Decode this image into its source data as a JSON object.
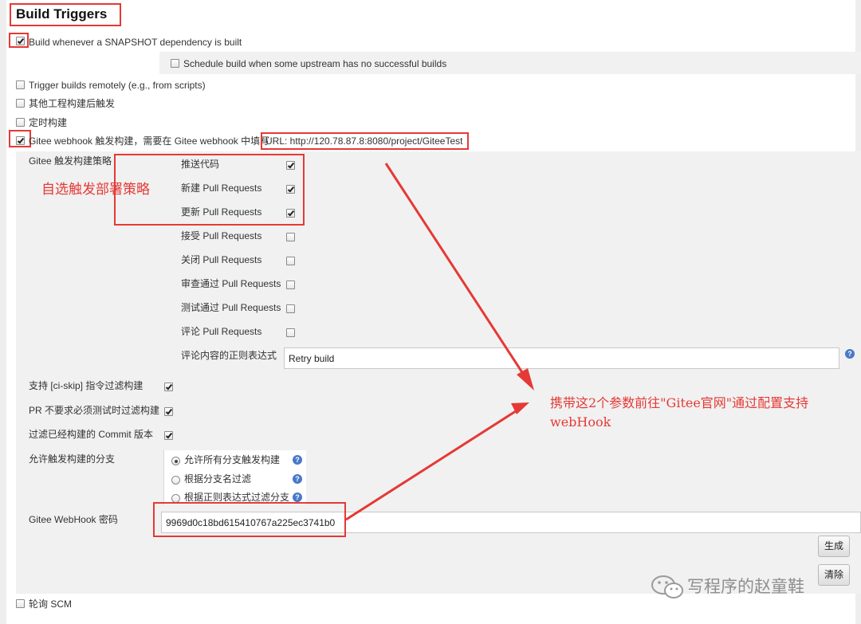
{
  "section": {
    "title": "Build Triggers"
  },
  "triggers": {
    "snapshot": {
      "label": "Build whenever a SNAPSHOT dependency is built",
      "checked": true
    },
    "schedule_upstream": {
      "label": "Schedule build when some upstream has no successful builds",
      "checked": false
    },
    "remote": {
      "label": "Trigger builds remotely (e.g., from scripts)",
      "checked": false
    },
    "after_other": {
      "label": "其他工程构建后触发",
      "checked": false
    },
    "periodic": {
      "label": "定时构建",
      "checked": false
    },
    "gitee": {
      "label": "Gitee webhook 触发构建，需要在 Gitee webhook 中填写",
      "url": "URL: http://120.78.87.8:8080/project/GiteeTest",
      "checked": true
    },
    "poll_scm": {
      "label": "轮询 SCM",
      "checked": false
    }
  },
  "gitee_config": {
    "strategy_label": "Gitee 触发构建策略",
    "strategies": [
      {
        "label": "推送代码",
        "checked": true
      },
      {
        "label": "新建 Pull Requests",
        "checked": true
      },
      {
        "label": "更新 Pull Requests",
        "checked": true
      },
      {
        "label": "接受 Pull Requests",
        "checked": false
      },
      {
        "label": "关闭 Pull Requests",
        "checked": false
      },
      {
        "label": "审查通过 Pull Requests",
        "checked": false
      },
      {
        "label": "测试通过 Pull Requests",
        "checked": false
      },
      {
        "label": "评论 Pull Requests",
        "checked": false
      }
    ],
    "comment_regex_label": "评论内容的正则表达式",
    "comment_regex_value": "Retry build",
    "options": [
      {
        "label": "支持 [ci-skip] 指令过滤构建",
        "checked": true
      },
      {
        "label": "PR 不要求必须测试时过滤构建",
        "checked": true
      },
      {
        "label": "过滤已经构建的 Commit 版本",
        "checked": true
      }
    ],
    "branch_label": "允许触发构建的分支",
    "branch_options": [
      {
        "label": "允许所有分支触发构建",
        "selected": true
      },
      {
        "label": "根据分支名过滤",
        "selected": false
      },
      {
        "label": "根据正则表达式过滤分支",
        "selected": false
      }
    ],
    "webhook_secret_label": "Gitee WebHook 密码",
    "webhook_secret_value": "9969d0c18bd615410767a225ec3741b0",
    "generate_button": "生成",
    "clear_button": "清除"
  },
  "annotations": {
    "strategy_note": "自选触发部署策略",
    "webhook_note_line1": "携带这2个参数前往\"Gitee官网\"通过配置支持",
    "webhook_note_line2": "webHook"
  },
  "watermark": {
    "text": "写程序的赵童鞋",
    "icon": "wechat-icon"
  },
  "help_icon_char": "?",
  "colors": {
    "annotation_red": "#e53935",
    "panel_gray": "#f1f1f1",
    "help_blue": "#4a78c8"
  }
}
